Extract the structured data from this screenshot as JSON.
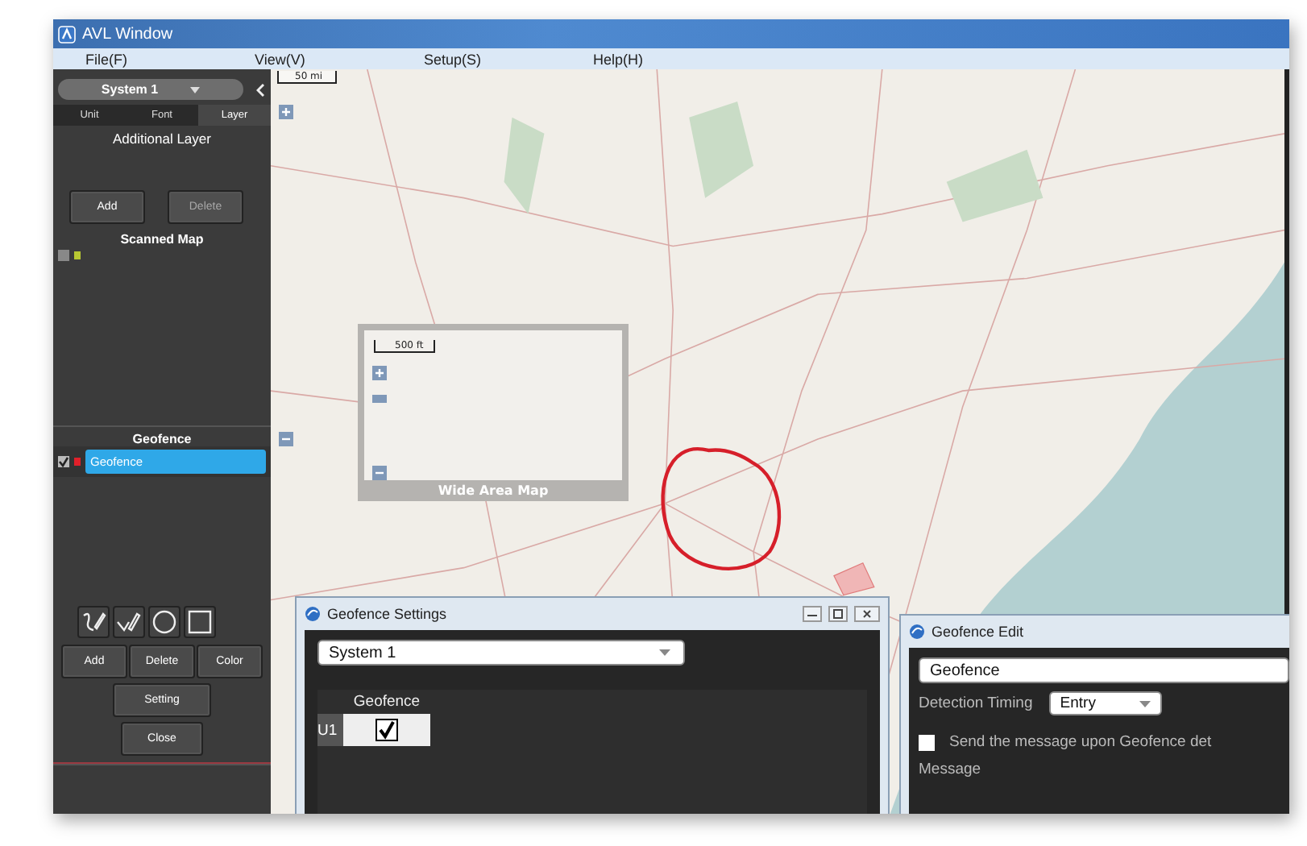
{
  "window": {
    "title": "AVL Window"
  },
  "menu": [
    "File(F)",
    "View(V)",
    "Setup(S)",
    "Help(H)"
  ],
  "sidebar": {
    "system": "System 1",
    "tabs": [
      {
        "label": "Unit",
        "selected": false
      },
      {
        "label": "Font",
        "selected": false
      },
      {
        "label": "Layer",
        "selected": true
      }
    ],
    "heading": "Additional Layer",
    "layer_buttons": [
      {
        "label": "Add",
        "disabled": false
      },
      {
        "label": "Delete",
        "disabled": true
      }
    ],
    "sections": [
      {
        "title": "Scanned Map",
        "items": [
          {
            "checked": false,
            "color": "#b8c832"
          }
        ]
      },
      {
        "title": "Geofence",
        "items": [
          {
            "label": "Geofence",
            "checked": true,
            "color": "#e0202a",
            "selected": true
          }
        ]
      }
    ],
    "tools": [
      {
        "kind": "freehand"
      },
      {
        "kind": "polyline"
      },
      {
        "kind": "circle"
      },
      {
        "kind": "rectangle"
      }
    ],
    "buttons": [
      "Add",
      "Delete",
      "Color"
    ],
    "setting": "Setting",
    "close": "Close"
  },
  "map": {
    "scale": "50 mi",
    "inset": {
      "scale": "500 ft",
      "caption": "Wide Area Map"
    }
  },
  "geofence_settings": {
    "title": "Geofence Settings",
    "system": "System 1",
    "column": "Geofence",
    "rows": [
      {
        "unit": "U1",
        "checked": true
      }
    ]
  },
  "geofence_edit": {
    "title": "Geofence Edit",
    "name": "Geofence",
    "timing_label": "Detection Timing",
    "timing": "Entry",
    "send_checked": false,
    "send_label": "Send the message upon Geofence det",
    "message_label": "Message"
  }
}
